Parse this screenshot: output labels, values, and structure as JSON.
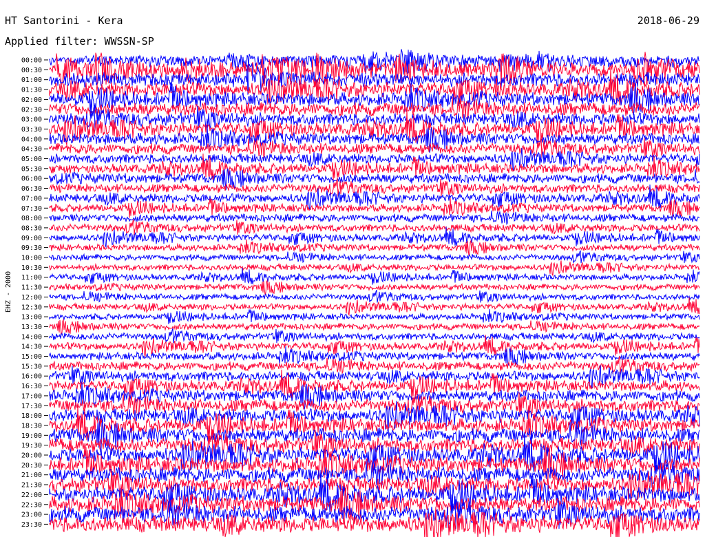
{
  "header": {
    "station": "HT Santorini - Kera",
    "date": "2018-06-29",
    "filter": "Applied filter: WWSSN-SP"
  },
  "chart_data": {
    "type": "line",
    "title": "HT Santorini - Kera",
    "ylabel": "EHZ - 2000",
    "row_labels": [
      "00:00",
      "00:30",
      "01:00",
      "01:30",
      "02:00",
      "02:30",
      "03:00",
      "03:30",
      "04:00",
      "04:30",
      "05:00",
      "05:30",
      "06:00",
      "06:30",
      "07:00",
      "07:30",
      "08:00",
      "08:30",
      "09:00",
      "09:30",
      "10:00",
      "10:30",
      "11:00",
      "11:30",
      "12:00",
      "12:30",
      "13:00",
      "13:30",
      "14:00",
      "14:30",
      "15:00",
      "15:30",
      "16:00",
      "16:30",
      "17:00",
      "17:30",
      "18:00",
      "18:30",
      "19:00",
      "19:30",
      "20:00",
      "20:30",
      "21:00",
      "21:30",
      "22:00",
      "22:30",
      "23:00",
      "23:30"
    ],
    "colors": [
      "#0000ff",
      "#ff0033"
    ],
    "grid": false,
    "amplitude": [
      1.7,
      1.7,
      1.6,
      1.6,
      1.5,
      1.5,
      1.4,
      1.4,
      1.3,
      1.2,
      1.1,
      1.1,
      1.1,
      1.0,
      1.0,
      0.9,
      0.9,
      0.85,
      0.8,
      0.75,
      0.7,
      0.7,
      0.7,
      0.7,
      0.7,
      0.7,
      0.7,
      0.75,
      0.8,
      0.85,
      0.9,
      1.0,
      1.1,
      1.2,
      1.3,
      1.4,
      1.5,
      1.5,
      1.6,
      1.6,
      1.7,
      1.7,
      1.7,
      1.7,
      1.8,
      1.8,
      1.8,
      1.8
    ]
  }
}
